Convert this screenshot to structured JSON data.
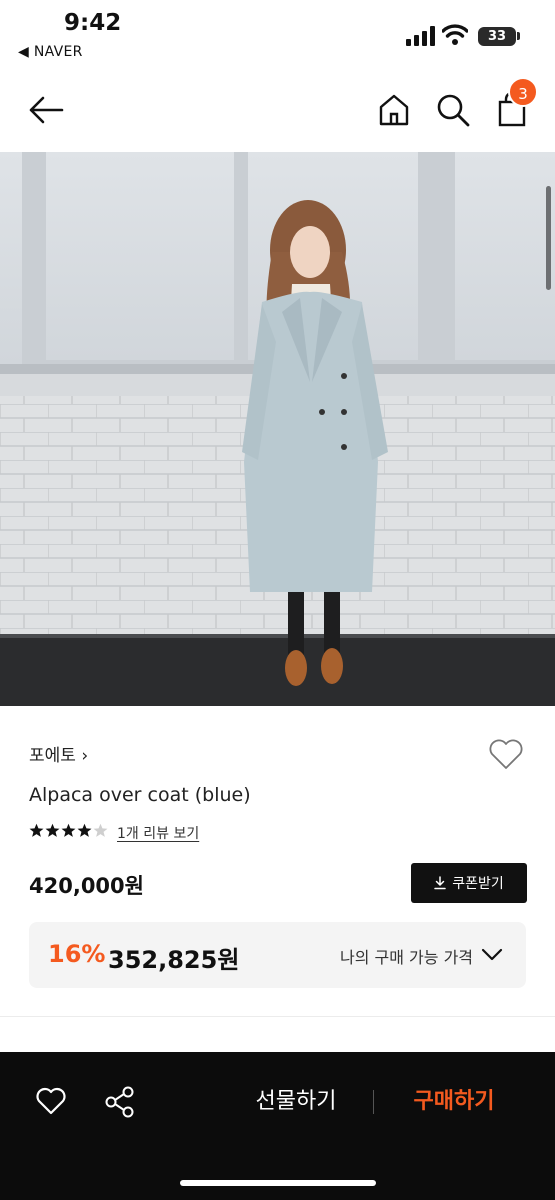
{
  "status_bar": {
    "time": "9:42",
    "back_app": "◀ NAVER",
    "battery": "33"
  },
  "nav": {
    "cart_count": "3"
  },
  "product": {
    "brand": "포에토 ›",
    "name": "Alpaca over coat (blue)",
    "rating": 4,
    "rating_max": 5,
    "review_link": "1개 리뷰 보기",
    "price": "420,000원",
    "coupon_label": "쿠폰받기",
    "discount_rate": "16%",
    "discount_price": "352,825원",
    "discount_label": "나의 구매 가능 가격"
  },
  "bottom_bar": {
    "gift_label": "선물하기",
    "buy_label": "구매하기"
  },
  "colors": {
    "accent": "#f45a1f",
    "bottom_bar": "#0c0c0c"
  }
}
